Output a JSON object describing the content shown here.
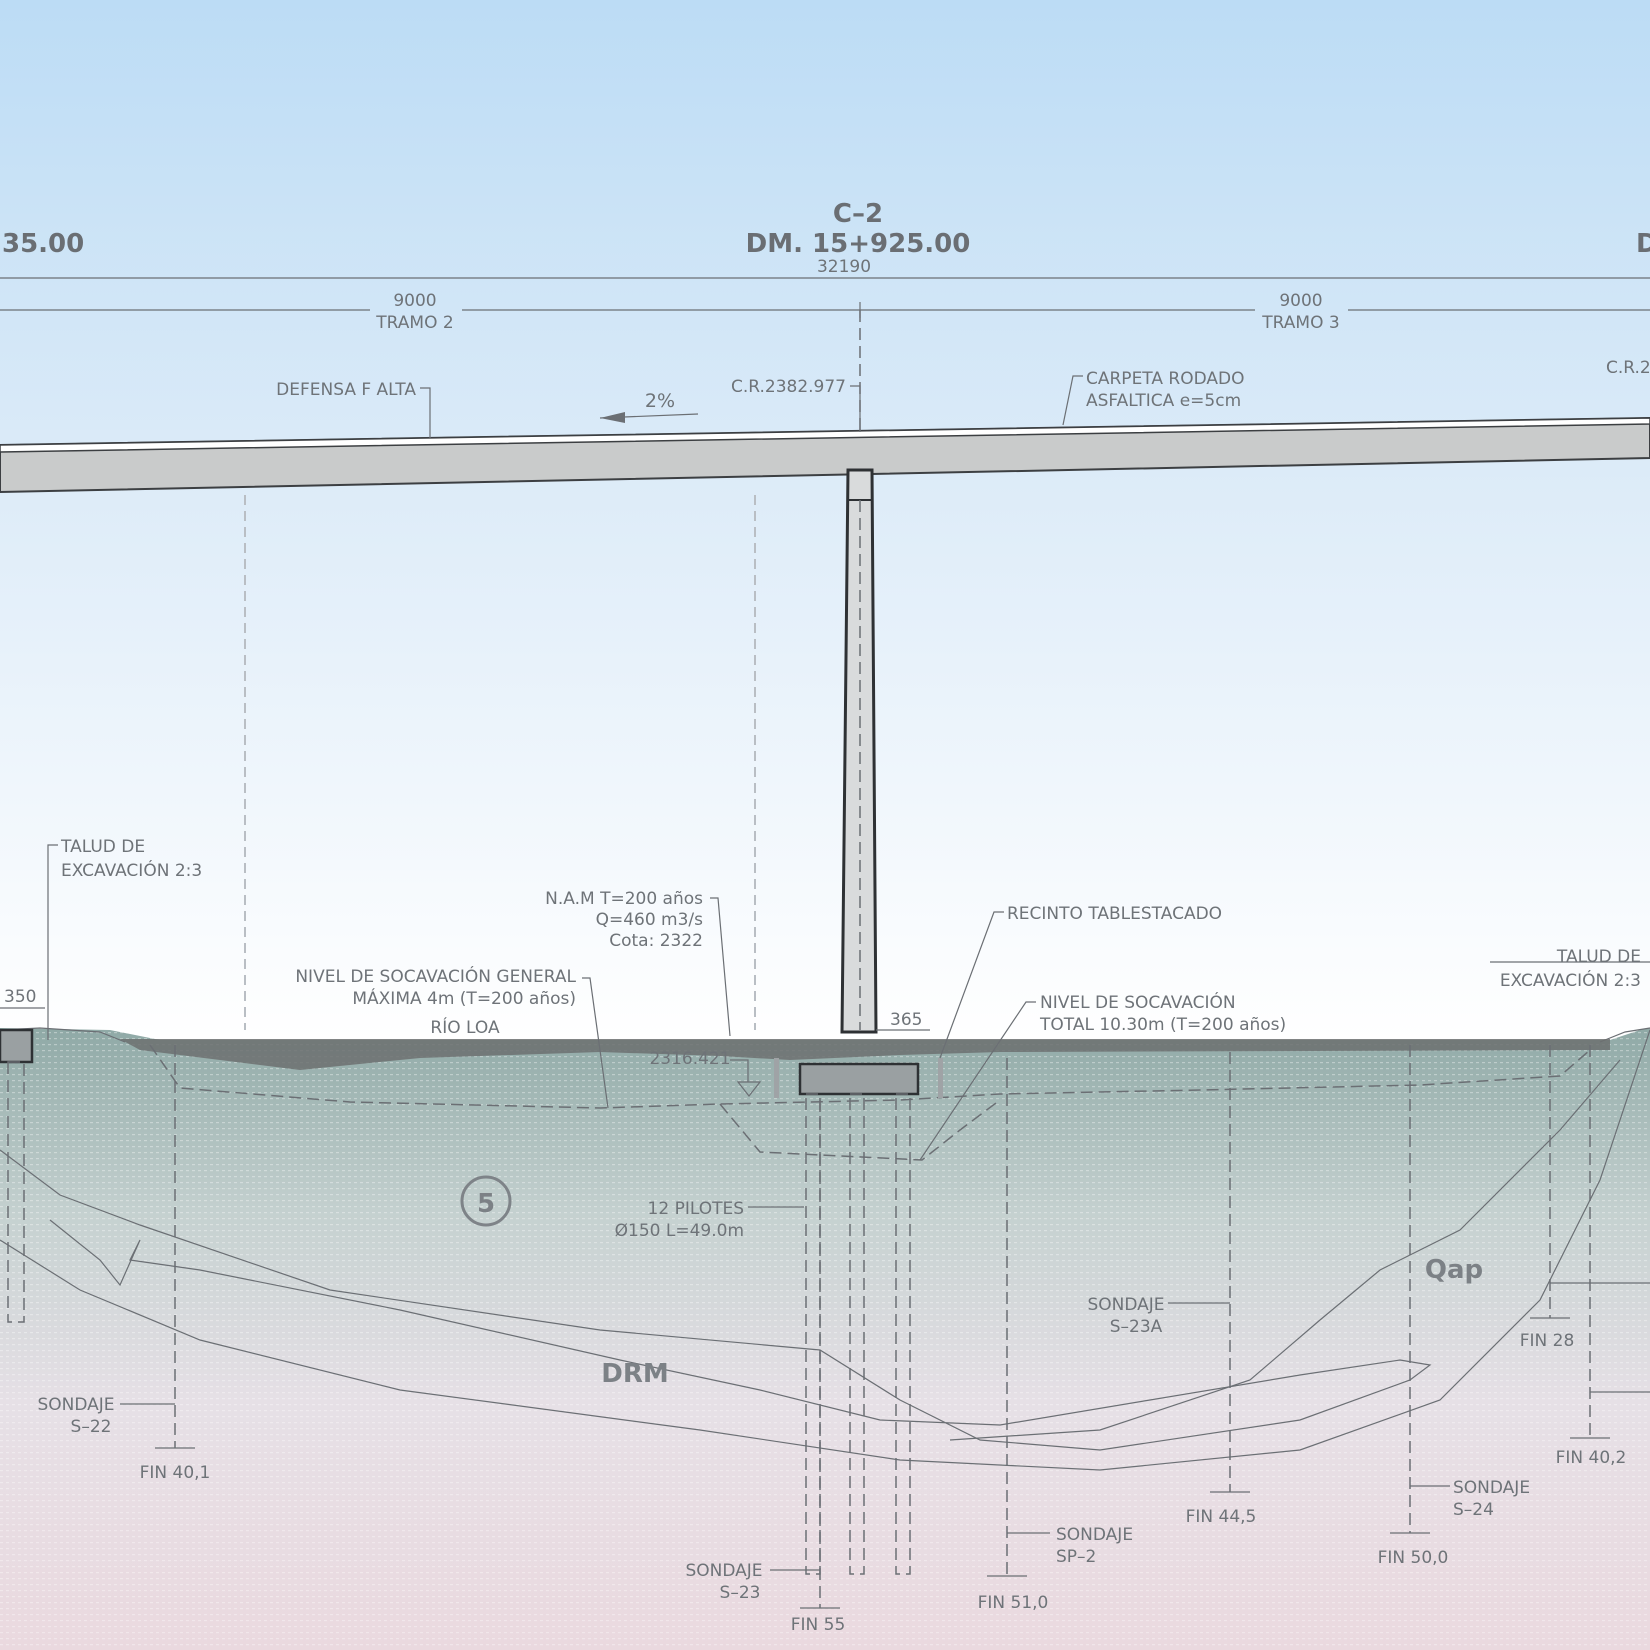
{
  "header": {
    "left_station_partial": "35.00",
    "axis_label": "C–2",
    "station": "DM.  15+925.00",
    "right_partial": "D",
    "total_length": "32190"
  },
  "spans": [
    {
      "length": "9000",
      "name": "TRAMO  2"
    },
    {
      "length": "9000",
      "name": "TRAMO  3"
    }
  ],
  "deck": {
    "defensa": "DEFENSA  F  ALTA",
    "slope": "2%",
    "crown_level": "C.R.2382.977",
    "crown_level_right_partial": "C.R.2",
    "carpeta_line1": "CARPETA  RODADO",
    "carpeta_line2": "ASFALTICA  e=5cm"
  },
  "annotations": {
    "talud_left_1": "TALUD  DE",
    "talud_left_2": "EXCAVACIÓN  2:3",
    "talud_right_1": "TALUD  DE",
    "talud_right_2": "EXCAVACIÓN  2:3",
    "dim_left": "350",
    "dim_pier": "365",
    "nam_1": "N.A.M  T=200  años",
    "nam_2": "Q=460  m3/s",
    "nam_3": "Cota:  2322",
    "scour_general_1": "NIVEL  DE  SOCAVACIÓN  GENERAL",
    "scour_general_2": "MÁXIMA  4m  (T=200  años)",
    "river": "RÍO  LOA",
    "level": "2316.421",
    "recinto": "RECINTO  TABLESTACADO",
    "scour_total_1": "NIVEL  DE  SOCAVACIÓN",
    "scour_total_2": "TOTAL  10.30m  (T=200  años)",
    "piles_1": "12  PILOTES",
    "piles_2": "Ø150  L=49.0m",
    "unit_number": "5"
  },
  "geology": {
    "drm": "DRM",
    "qap": "Qap"
  },
  "boreholes": [
    {
      "label": "SONDAJE",
      "id": "S–22",
      "end": "FIN  40,1"
    },
    {
      "label": "SONDAJE",
      "id": "S–23",
      "end": "FIN  55"
    },
    {
      "label": "SONDAJE",
      "id": "SP–2",
      "end": "FIN  51,0"
    },
    {
      "label": "SONDAJE",
      "id": "S–23A",
      "end": "FIN  44,5"
    },
    {
      "label": "SONDAJE",
      "id": "S–24",
      "end": "FIN  50,0"
    },
    {
      "label": "",
      "id": "",
      "end": "FIN  28"
    },
    {
      "label": "",
      "id": "",
      "end": "FIN  40,2"
    }
  ],
  "colors": {
    "sky_top": "#bcdcf5",
    "sky_bottom": "#ffffff",
    "soil_top": "#93ada9",
    "soil_bottom": "#e9dde2",
    "deck": "#c9cbcb",
    "water": "#6c7070"
  }
}
